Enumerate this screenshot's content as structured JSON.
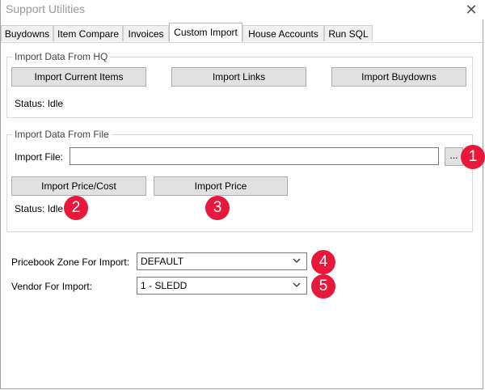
{
  "window": {
    "title": "Support Utilities"
  },
  "tabs": [
    {
      "label": "Buydowns"
    },
    {
      "label": "Item Compare"
    },
    {
      "label": "Invoices"
    },
    {
      "label": "Custom Import"
    },
    {
      "label": "House Accounts"
    },
    {
      "label": "Run SQL"
    }
  ],
  "hq_group": {
    "legend": "Import Data From HQ",
    "import_current_items": "Import Current Items",
    "import_links": "Import Links",
    "import_buydowns": "Import Buydowns",
    "status": "Status: Idle"
  },
  "file_group": {
    "legend": "Import Data From File",
    "import_file_label": "Import File:",
    "import_file_value": "",
    "browse": "...",
    "import_price_cost": "Import Price/Cost",
    "import_price": "Import Price",
    "status": "Status: Idle"
  },
  "zone": {
    "label": "Pricebook Zone For Import:",
    "value": "DEFAULT"
  },
  "vendor": {
    "label": "Vendor For Import:",
    "value": "1 - SLEDD"
  },
  "callouts": [
    "1",
    "2",
    "3",
    "4",
    "5"
  ],
  "colors": {
    "callout": "#e8173c"
  }
}
